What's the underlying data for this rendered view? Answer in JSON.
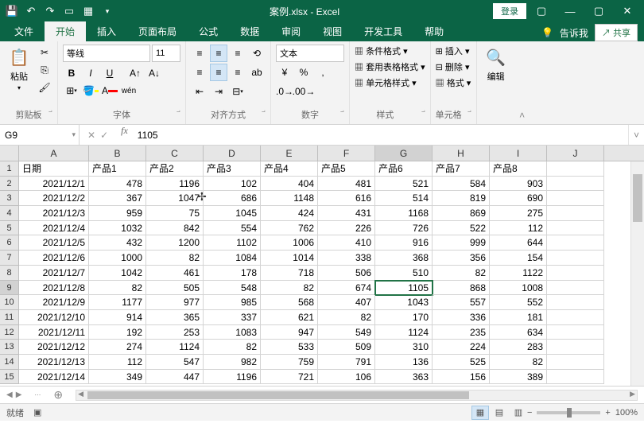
{
  "title": "案例.xlsx - Excel",
  "login": "登录",
  "share": "共享",
  "tell_me": "告诉我",
  "tabs": [
    "文件",
    "开始",
    "插入",
    "页面布局",
    "公式",
    "数据",
    "审阅",
    "视图",
    "开发工具",
    "帮助"
  ],
  "active_tab": 1,
  "ribbon": {
    "clipboard": {
      "label": "剪贴板",
      "paste": "粘贴"
    },
    "font": {
      "label": "字体",
      "name": "等线",
      "size": "11"
    },
    "align": {
      "label": "对齐方式"
    },
    "number": {
      "label": "数字",
      "format": "文本"
    },
    "styles": {
      "label": "样式",
      "cond": "条件格式",
      "table": "套用表格格式",
      "cell": "单元格样式"
    },
    "cells": {
      "label": "单元格",
      "insert": "插入",
      "delete": "删除",
      "format": "格式"
    },
    "edit": {
      "label": "编辑"
    }
  },
  "namebox": "G9",
  "formula": "1105",
  "active_cell": {
    "row": 9,
    "col": "G"
  },
  "columns": [
    "A",
    "B",
    "C",
    "D",
    "E",
    "F",
    "G",
    "H",
    "I",
    "J"
  ],
  "headers": [
    "日期",
    "产品1",
    "产品2",
    "产品3",
    "产品4",
    "产品5",
    "产品6",
    "产品7",
    "产品8"
  ],
  "rows": [
    {
      "n": 1
    },
    {
      "n": 2,
      "d": "2021/12/1",
      "v": [
        478,
        1196,
        102,
        404,
        481,
        521,
        584,
        903
      ]
    },
    {
      "n": 3,
      "d": "2021/12/2",
      "v": [
        367,
        1047,
        686,
        1148,
        616,
        514,
        819,
        690
      ]
    },
    {
      "n": 4,
      "d": "2021/12/3",
      "v": [
        959,
        "75",
        1045,
        424,
        431,
        1168,
        869,
        275
      ]
    },
    {
      "n": 5,
      "d": "2021/12/4",
      "v": [
        1032,
        842,
        554,
        762,
        226,
        726,
        522,
        112
      ]
    },
    {
      "n": 6,
      "d": "2021/12/5",
      "v": [
        432,
        1200,
        1102,
        1006,
        410,
        916,
        999,
        644
      ]
    },
    {
      "n": 7,
      "d": "2021/12/6",
      "v": [
        1000,
        82,
        1084,
        1014,
        338,
        368,
        356,
        154
      ]
    },
    {
      "n": 8,
      "d": "2021/12/7",
      "v": [
        1042,
        461,
        178,
        718,
        506,
        510,
        82,
        1122
      ]
    },
    {
      "n": 9,
      "d": "2021/12/8",
      "v": [
        82,
        505,
        548,
        82,
        674,
        1105,
        868,
        1008
      ]
    },
    {
      "n": 10,
      "d": "2021/12/9",
      "v": [
        1177,
        977,
        985,
        568,
        407,
        1043,
        557,
        552
      ]
    },
    {
      "n": 11,
      "d": "2021/12/10",
      "v": [
        914,
        365,
        337,
        621,
        82,
        170,
        336,
        181
      ]
    },
    {
      "n": 12,
      "d": "2021/12/11",
      "v": [
        192,
        253,
        1083,
        947,
        549,
        1124,
        235,
        634
      ]
    },
    {
      "n": 13,
      "d": "2021/12/12",
      "v": [
        274,
        1124,
        82,
        533,
        509,
        310,
        224,
        283
      ]
    },
    {
      "n": 14,
      "d": "2021/12/13",
      "v": [
        112,
        547,
        982,
        759,
        791,
        136,
        525,
        82
      ]
    },
    {
      "n": 15,
      "d": "2021/12/14",
      "v": [
        349,
        447,
        1196,
        721,
        106,
        363,
        156,
        389
      ]
    }
  ],
  "status": {
    "ready": "就绪",
    "zoom": "100%"
  },
  "c4_display": "75"
}
